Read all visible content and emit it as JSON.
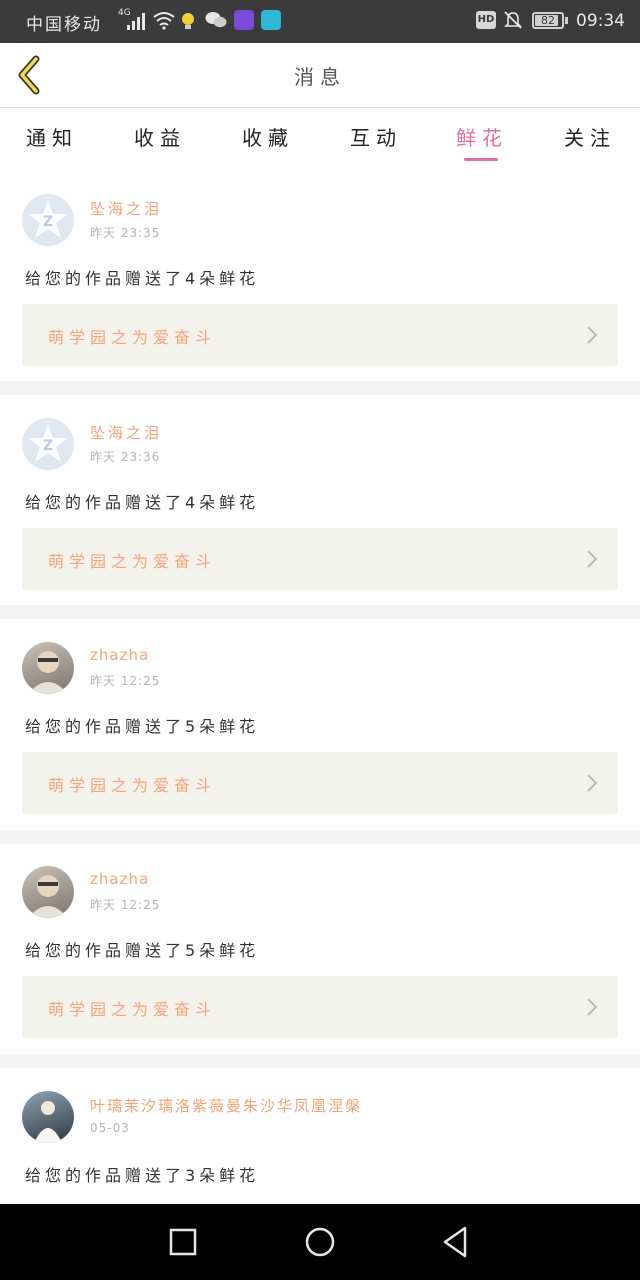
{
  "status_bar": {
    "carrier": "中国移动",
    "network": "4G",
    "battery_level": "82",
    "time": "09:34",
    "hd_label": "HD",
    "icons": [
      "signal-icon",
      "wifi-icon",
      "bulb-icon",
      "wechat-icon",
      "video-app-icon",
      "reader-app-icon",
      "mute-bell-icon"
    ]
  },
  "header": {
    "title": "消息",
    "back_icon": "chevron-left-icon"
  },
  "tabs": [
    {
      "label": "通知",
      "active": false
    },
    {
      "label": "收益",
      "active": false
    },
    {
      "label": "收藏",
      "active": false
    },
    {
      "label": "互动",
      "active": false
    },
    {
      "label": "鲜花",
      "active": true
    },
    {
      "label": "关注",
      "active": false
    }
  ],
  "messages": [
    {
      "user": "坠海之泪",
      "time": "昨天 23:35",
      "text": "给您的作品赠送了4朵鲜花",
      "work": "萌学园之为爱奋斗"
    },
    {
      "user": "坠海之泪",
      "time": "昨天 23:36",
      "text": "给您的作品赠送了4朵鲜花",
      "work": "萌学园之为爱奋斗"
    },
    {
      "user": "zhazha",
      "time": "昨天 12:25",
      "text": "给您的作品赠送了5朵鲜花",
      "work": "萌学园之为爱奋斗"
    },
    {
      "user": "zhazha",
      "time": "昨天 12:25",
      "text": "给您的作品赠送了5朵鲜花",
      "work": "萌学园之为爱奋斗"
    },
    {
      "user": "叶璃茉汐璃洛紫薇曼朱沙华凤凰涅槃",
      "time": "05-03",
      "text": "给您的作品赠送了3朵鲜花"
    }
  ],
  "nav_bar": {
    "buttons": [
      "recent-apps-icon",
      "home-icon",
      "back-icon"
    ]
  },
  "colors": {
    "accent": "#e56da5",
    "name": "#f0a57a",
    "work_bg": "#f3f3ec"
  }
}
